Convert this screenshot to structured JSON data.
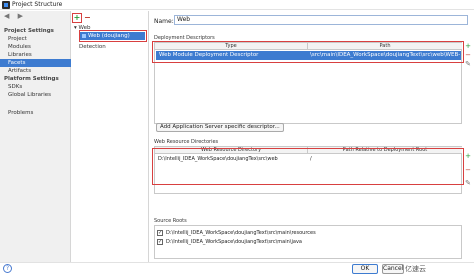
{
  "window": {
    "title": "Project Structure"
  },
  "nav": {
    "project_settings": "Project Settings",
    "items_project": [
      "Project",
      "Modules",
      "Libraries",
      "Facets",
      "Artifacts"
    ],
    "platform_settings": "Platform Settings",
    "items_platform": [
      "SDKs",
      "Global Libraries"
    ],
    "problems": "Problems",
    "selected": "Facets"
  },
  "tree": {
    "add_icon": "+",
    "remove_icon": "−",
    "root": "Web",
    "selected_item": "Web (doujiang)",
    "detection": "Detection"
  },
  "detail": {
    "name_label": "Name:",
    "name_value": "Web",
    "deployment_descriptors": "Deployment Descriptors",
    "dd_headers": [
      "Type",
      "Path"
    ],
    "dd_row": {
      "type": "Web Module Deployment Descriptor",
      "path": "\\src\\main\\IDEA_WorkSpace\\doujiangText\\src\\web\\WEB-INF\\web.xml"
    },
    "add_server_descriptor": "Add Application Server specific descriptor...",
    "web_resource_dirs": "Web Resource Directories",
    "wr_headers": [
      "Web Resource Directory",
      "Path Relative to Deployment Root"
    ],
    "wr_row": {
      "dir": "D:\\Intellij_IDEA_WorkSpace\\doujiangTex\\src\\web",
      "rel": "/"
    },
    "source_roots": "Source Roots",
    "source_list": [
      "D:\\Intellij_IDEA_WorkSpace\\doujiangText\\src\\main\\resources",
      "D:\\Intellij_IDEA_WorkSpace\\doujiangText\\src\\main\\java"
    ]
  },
  "footer": {
    "help": "?",
    "ok": "OK",
    "cancel": "Cancel",
    "watermark": "亿速云"
  },
  "colors": {
    "accent": "#3d7bd0",
    "highlight_box": "#d84040",
    "add_green": "#2a9d3a"
  }
}
